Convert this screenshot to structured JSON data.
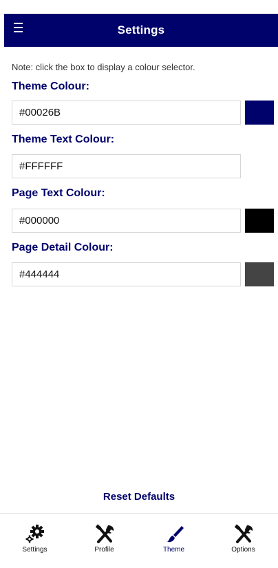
{
  "header": {
    "title": "Settings",
    "menu_icon": "menu-icon"
  },
  "note": "Note: click the box to display a colour selector.",
  "fields": [
    {
      "label": "Theme Colour:",
      "value": "#00026B",
      "swatch": "#00026B"
    },
    {
      "label": "Theme Text Colour:",
      "value": "#FFFFFF",
      "swatch": "#FFFFFF"
    },
    {
      "label": "Page Text Colour:",
      "value": "#000000",
      "swatch": "#000000"
    },
    {
      "label": "Page Detail Colour:",
      "value": "#444444",
      "swatch": "#444444"
    }
  ],
  "reset_label": "Reset Defaults",
  "colors": {
    "accent": "#00026B"
  },
  "tabs": [
    {
      "label": "Settings",
      "icon": "gears-icon"
    },
    {
      "label": "Profile",
      "icon": "tools-icon"
    },
    {
      "label": "Theme",
      "icon": "brush-icon",
      "active": true
    },
    {
      "label": "Options",
      "icon": "tools-icon"
    }
  ]
}
